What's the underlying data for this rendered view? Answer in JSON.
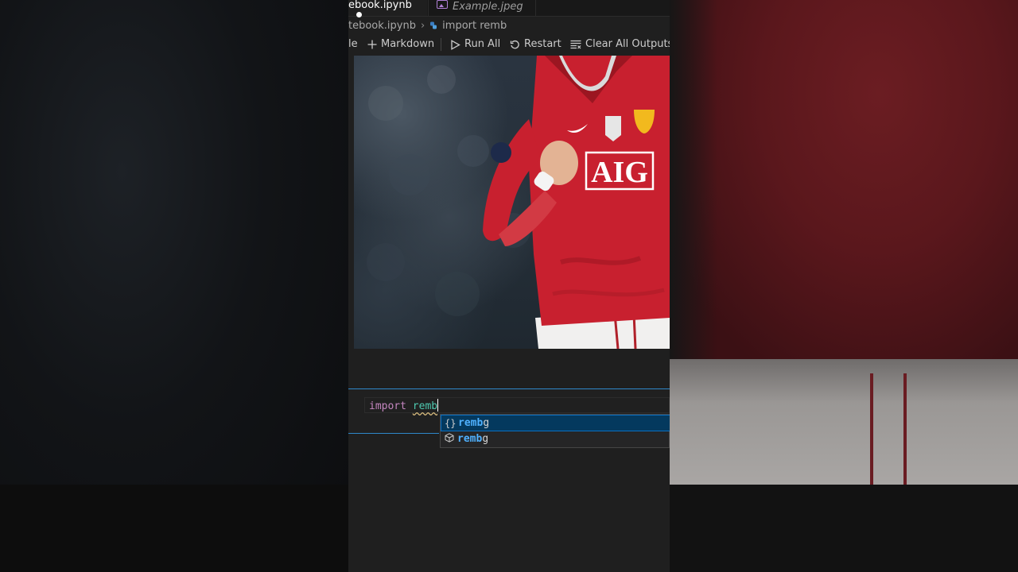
{
  "tabs": {
    "active_label": "ebook.ipynb",
    "inactive_label": "Example.jpeg"
  },
  "breadcrumb": {
    "file": "tebook.ipynb",
    "cell": "import remb"
  },
  "toolbar": {
    "code_label": "le",
    "markdown_label": "Markdown",
    "run_all_label": "Run All",
    "restart_label": "Restart",
    "clear_label": "Clear All Outputs"
  },
  "photo": {
    "shirt_text": "AIG"
  },
  "code_cell": {
    "keyword": "import",
    "typed": "remb"
  },
  "suggestions": [
    {
      "icon": "module-braces-icon",
      "match": "remb",
      "rest": "g"
    },
    {
      "icon": "package-cube-icon",
      "match": "remb",
      "rest": "g"
    }
  ],
  "colors": {
    "accent": "#2f87c9",
    "selection": "#04395e",
    "match": "#4fb1ff",
    "keyword": "#c586c0",
    "module": "#4ec9b0",
    "shirt_red": "#c8202f"
  }
}
